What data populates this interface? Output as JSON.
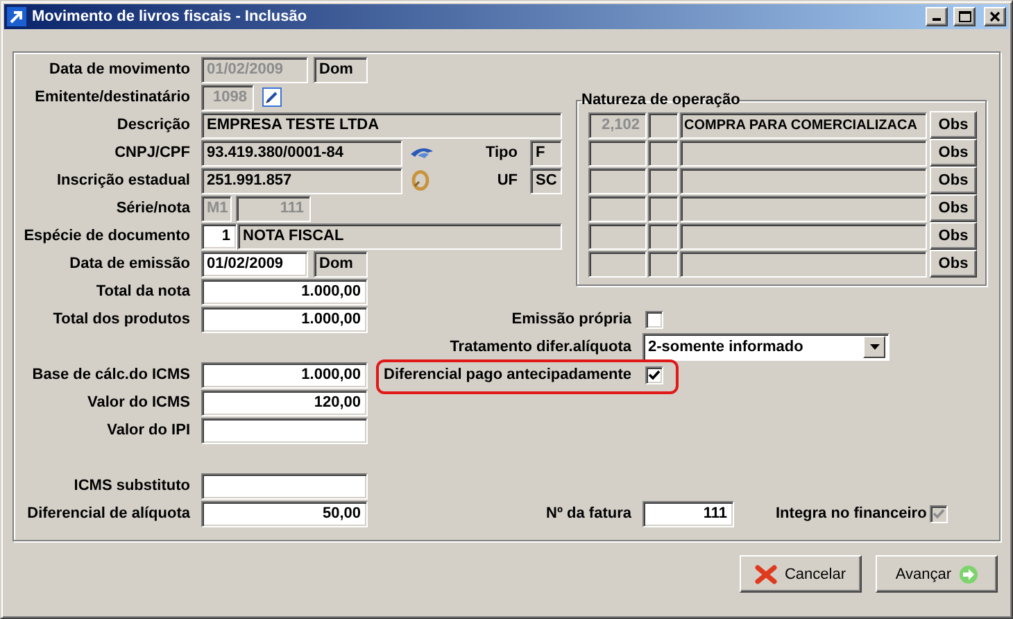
{
  "window": {
    "title": "Movimento de livros fiscais - Inclusão"
  },
  "fields": [
    {
      "label": "Data de movimento",
      "items": [
        {
          "kind": "date",
          "disabled": true,
          "value": "01/02/2009"
        },
        {
          "kind": "weekday",
          "disabled": false,
          "readonly": true,
          "value": "Dom"
        }
      ]
    },
    {
      "label": "Emitente/destinatário",
      "items": [
        {
          "kind": "code",
          "disabled": true,
          "value": "1098"
        },
        {
          "kind": "edit_icon"
        }
      ]
    },
    {
      "label": "Descrição",
      "items": [
        {
          "kind": "name",
          "disabled": false,
          "readonly": true,
          "value": "EMPRESA TESTE LTDA"
        }
      ]
    },
    {
      "label": "CNPJ/CPF",
      "items": [
        {
          "kind": "document",
          "disabled": false,
          "readonly": true,
          "value": "93.419.380/0001-84"
        },
        {
          "kind": "swoosh_icon"
        },
        {
          "kind": "side_field",
          "label": "Tipo",
          "disabled": false,
          "readonly": true,
          "value": "F"
        }
      ]
    },
    {
      "label": "Inscrição estadual",
      "items": [
        {
          "kind": "document",
          "disabled": false,
          "readonly": true,
          "value": "251.991.857"
        },
        {
          "kind": "ring_icon"
        },
        {
          "kind": "side_field",
          "label": "UF",
          "disabled": false,
          "readonly": true,
          "value": "SC"
        }
      ]
    },
    {
      "label": "Série/nota",
      "items": [
        {
          "kind": "series",
          "disabled": true,
          "value": "M1"
        },
        {
          "kind": "number",
          "disabled": true,
          "value": "111"
        }
      ]
    },
    {
      "label": "Espécie de documento",
      "items": [
        {
          "kind": "doc_code",
          "disabled": false,
          "readonly": false,
          "value": "1"
        },
        {
          "kind": "doc_name",
          "disabled": false,
          "readonly": true,
          "value": "NOTA FISCAL"
        }
      ]
    },
    {
      "label": "Data de emissão",
      "items": [
        {
          "kind": "date",
          "disabled": false,
          "readonly": false,
          "value": "01/02/2009"
        },
        {
          "kind": "weekday",
          "disabled": false,
          "readonly": true,
          "value": "Dom"
        }
      ]
    },
    {
      "label": "Total da nota",
      "items": [
        {
          "kind": "amount",
          "disabled": false,
          "readonly": false,
          "value": "1.000,00"
        }
      ]
    }
  ],
  "nature": {
    "title": "Natureza de operação",
    "rows": [
      {
        "code": "2,102",
        "description": "COMPRA PARA COMERCIALIZACA",
        "button": "Obs"
      },
      {
        "button": "Obs"
      },
      {
        "button": "Obs"
      },
      {
        "button": "Obs"
      },
      {
        "button": "Obs"
      },
      {
        "button": "Obs"
      }
    ]
  },
  "tax_rows": [
    {
      "label": "Total dos produtos",
      "value": "1.000,00",
      "option": {
        "kind": "checkbox",
        "label": "Emissão própria",
        "checked": false,
        "highlighted": false
      }
    },
    {
      "option": {
        "kind": "select",
        "label": "Tratamento difer.alíquota",
        "value": "2-somente informado"
      }
    },
    {
      "label": "Base de cálc.do ICMS",
      "value": "1.000,00",
      "option": {
        "kind": "checkbox",
        "label": "Diferencial pago antecipadamente",
        "checked": true,
        "highlighted": true
      }
    },
    {
      "label": "Valor do ICMS",
      "value": "120,00"
    },
    {
      "label": "Valor do IPI"
    }
  ],
  "extra_rows": [
    {
      "label": "ICMS substituto"
    },
    {
      "label": "Diferencial de alíquota",
      "value": "50,00",
      "invoice": {
        "label": "Nº da fatura",
        "value": "111"
      },
      "integration": {
        "label": "Integra no financeiro",
        "checked": true,
        "disabled": true
      }
    }
  ],
  "buttons": [
    {
      "kind": "cancel",
      "label": "Cancelar"
    },
    {
      "kind": "next",
      "label": "Avançar"
    }
  ]
}
